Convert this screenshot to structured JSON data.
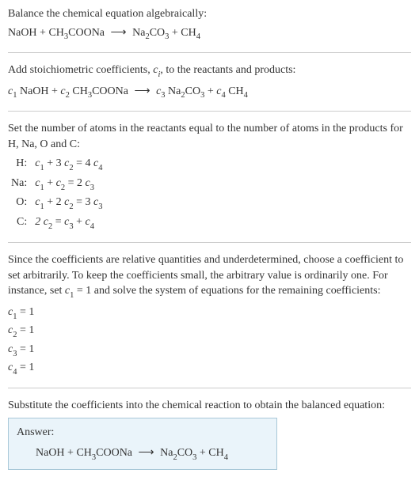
{
  "intro": {
    "line1": "Balance the chemical equation algebraically:",
    "eq_lhs1": "NaOH + CH",
    "eq_lhs2": "COONa",
    "eq_rhs1": "Na",
    "eq_rhs2": "CO",
    "eq_rhs3": " + CH"
  },
  "step1": {
    "text_a": "Add stoichiometric coefficients, ",
    "ci": "c",
    "ci_sub": "i",
    "text_b": ", to the reactants and products:",
    "c1": "c",
    "c1s": "1",
    "r1": " NaOH + ",
    "c2": "c",
    "c2s": "2",
    "r2a": " CH",
    "r2b": "COONa",
    "c3": "c",
    "c3s": "3",
    "r3a": " Na",
    "r3b": "CO",
    "c4": "c",
    "c4s": "4",
    "r4a": " CH"
  },
  "step2": {
    "text": "Set the number of atoms in the reactants equal to the number of atoms in the products for H, Na, O and C:",
    "rows": [
      {
        "el": "H:",
        "lhs_a": "c",
        "lhs_as": "1",
        "lhs_mid": " + 3 ",
        "lhs_b": "c",
        "lhs_bs": "2",
        "eq": " = 4 ",
        "rhs_a": "c",
        "rhs_as": "4",
        "rhs_tail": ""
      },
      {
        "el": "Na:",
        "lhs_a": "c",
        "lhs_as": "1",
        "lhs_mid": " + ",
        "lhs_b": "c",
        "lhs_bs": "2",
        "eq": " = 2 ",
        "rhs_a": "c",
        "rhs_as": "3",
        "rhs_tail": ""
      },
      {
        "el": "O:",
        "lhs_a": "c",
        "lhs_as": "1",
        "lhs_mid": " + 2 ",
        "lhs_b": "c",
        "lhs_bs": "2",
        "eq": " = 3 ",
        "rhs_a": "c",
        "rhs_as": "3",
        "rhs_tail": ""
      },
      {
        "el": "C:",
        "lhs_a": "2 c",
        "lhs_as": "2",
        "lhs_mid": "",
        "lhs_b": "",
        "lhs_bs": "",
        "eq": " = ",
        "rhs_a": "c",
        "rhs_as": "3",
        "rhs_tail_a": " + ",
        "rhs_b": "c",
        "rhs_bs": "4"
      }
    ]
  },
  "step3": {
    "text_a": "Since the coefficients are relative quantities and underdetermined, choose a coefficient to set arbitrarily. To keep the coefficients small, the arbitrary value is ordinarily one. For instance, set ",
    "cset": "c",
    "cset_s": "1",
    "text_b": " = 1 and solve the system of equations for the remaining coefficients:",
    "sol": [
      {
        "c": "c",
        "s": "1",
        "v": " = 1"
      },
      {
        "c": "c",
        "s": "2",
        "v": " = 1"
      },
      {
        "c": "c",
        "s": "3",
        "v": " = 1"
      },
      {
        "c": "c",
        "s": "4",
        "v": " = 1"
      }
    ]
  },
  "step4": {
    "text": "Substitute the coefficients into the chemical reaction to obtain the balanced equation:"
  },
  "answer": {
    "label": "Answer:",
    "lhs1": "NaOH + CH",
    "lhs2": "COONa",
    "rhs1": "Na",
    "rhs2": "CO",
    "rhs3": " + CH"
  },
  "subs": {
    "three": "3",
    "two": "2",
    "four": "4"
  },
  "arrow": "⟶"
}
